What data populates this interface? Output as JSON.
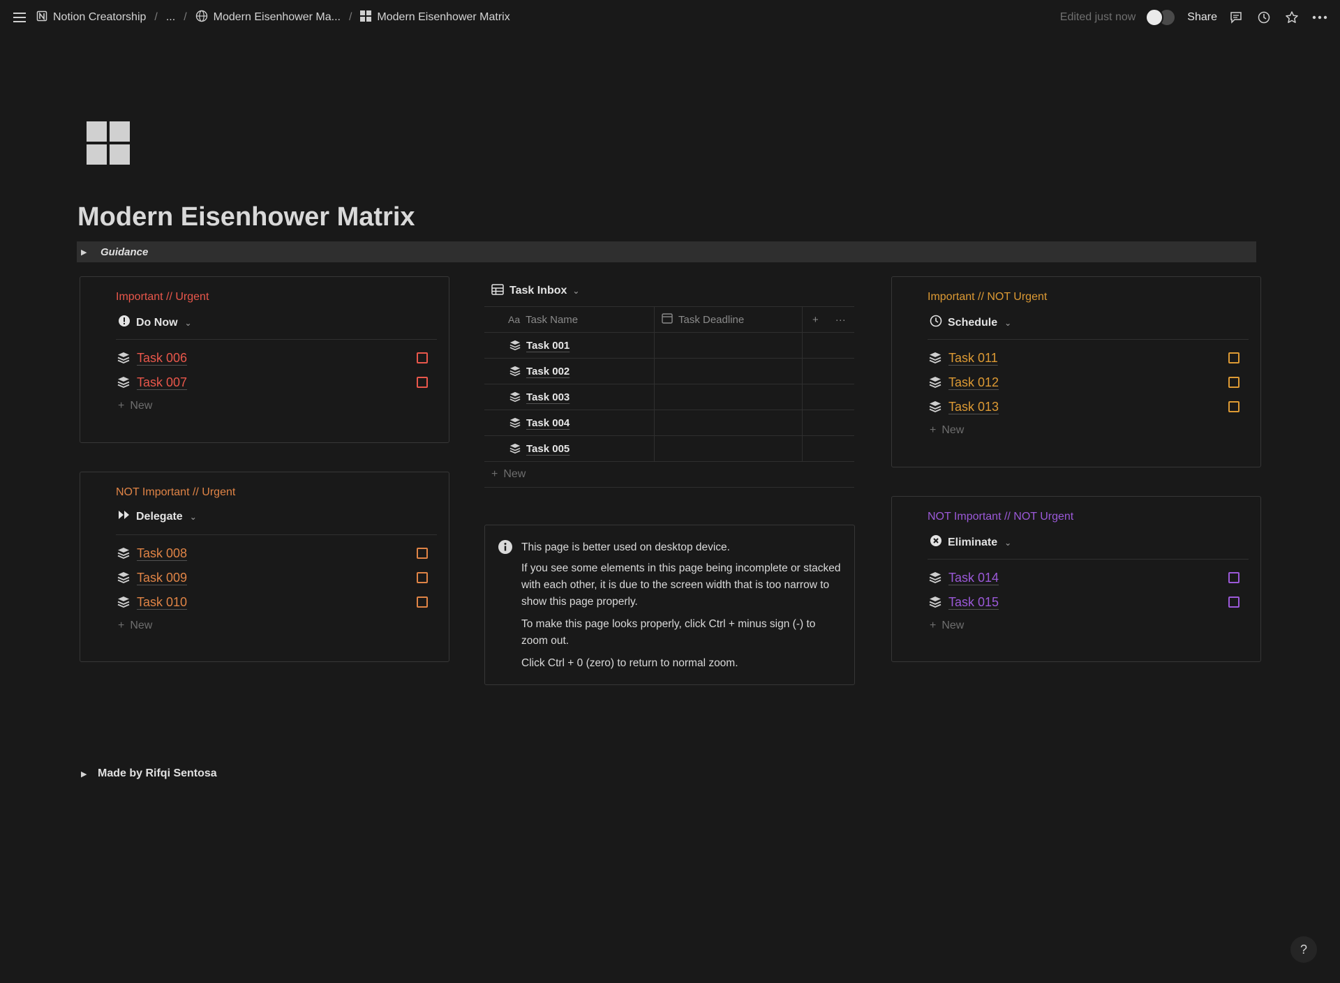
{
  "topbar": {
    "workspace": "Notion Creatorship",
    "ellipsis": "...",
    "crumb_parent": "Modern Eisenhower Ma...",
    "crumb_current": "Modern Eisenhower Matrix",
    "edited": "Edited just now",
    "share": "Share",
    "icons": [
      "menu-icon",
      "notion-icon",
      "globe-icon",
      "grid-icon",
      "comment-icon",
      "clock-icon",
      "star-icon",
      "more-icon"
    ]
  },
  "page": {
    "title": "Modern Eisenhower Matrix",
    "guidance": "Guidance",
    "footer": "Made by Rifqi Sentosa",
    "help": "?"
  },
  "colors": {
    "red": "#e9574b",
    "orange": "#e08446",
    "amber": "#dd9a34",
    "purple": "#9b59d8",
    "background": "#191919"
  },
  "quadrants": {
    "do_now": {
      "heading": "Important // Urgent",
      "view": "Do Now",
      "tasks": [
        "Task 006",
        "Task 007"
      ],
      "new": "New"
    },
    "delegate": {
      "heading": "NOT Important // Urgent",
      "view": "Delegate",
      "tasks": [
        "Task 008",
        "Task 009",
        "Task 010"
      ],
      "new": "New"
    },
    "schedule": {
      "heading": "Important // NOT Urgent",
      "view": "Schedule",
      "tasks": [
        "Task 011",
        "Task 012",
        "Task 013"
      ],
      "new": "New"
    },
    "eliminate": {
      "heading": "NOT Important // NOT Urgent",
      "view": "Eliminate",
      "tasks": [
        "Task 014",
        "Task 015"
      ],
      "new": "New"
    }
  },
  "inbox": {
    "title": "Task Inbox",
    "col_name_prefix": "Aa",
    "col_name": "Task Name",
    "col_deadline": "Task Deadline",
    "add": "+",
    "more": "···",
    "rows": [
      "Task 001",
      "Task 002",
      "Task 003",
      "Task 004",
      "Task 005"
    ],
    "new": "New"
  },
  "callout": {
    "line1": "This page is better used on desktop device.",
    "line2": "If you see some elements in this page being incomplete or stacked with each other, it is due to the screen width that is too narrow to show this page properly.",
    "line3": "To make this page looks properly, click Ctrl + minus sign (-) to zoom out.",
    "line4": "Click Ctrl + 0 (zero) to return to normal zoom."
  }
}
